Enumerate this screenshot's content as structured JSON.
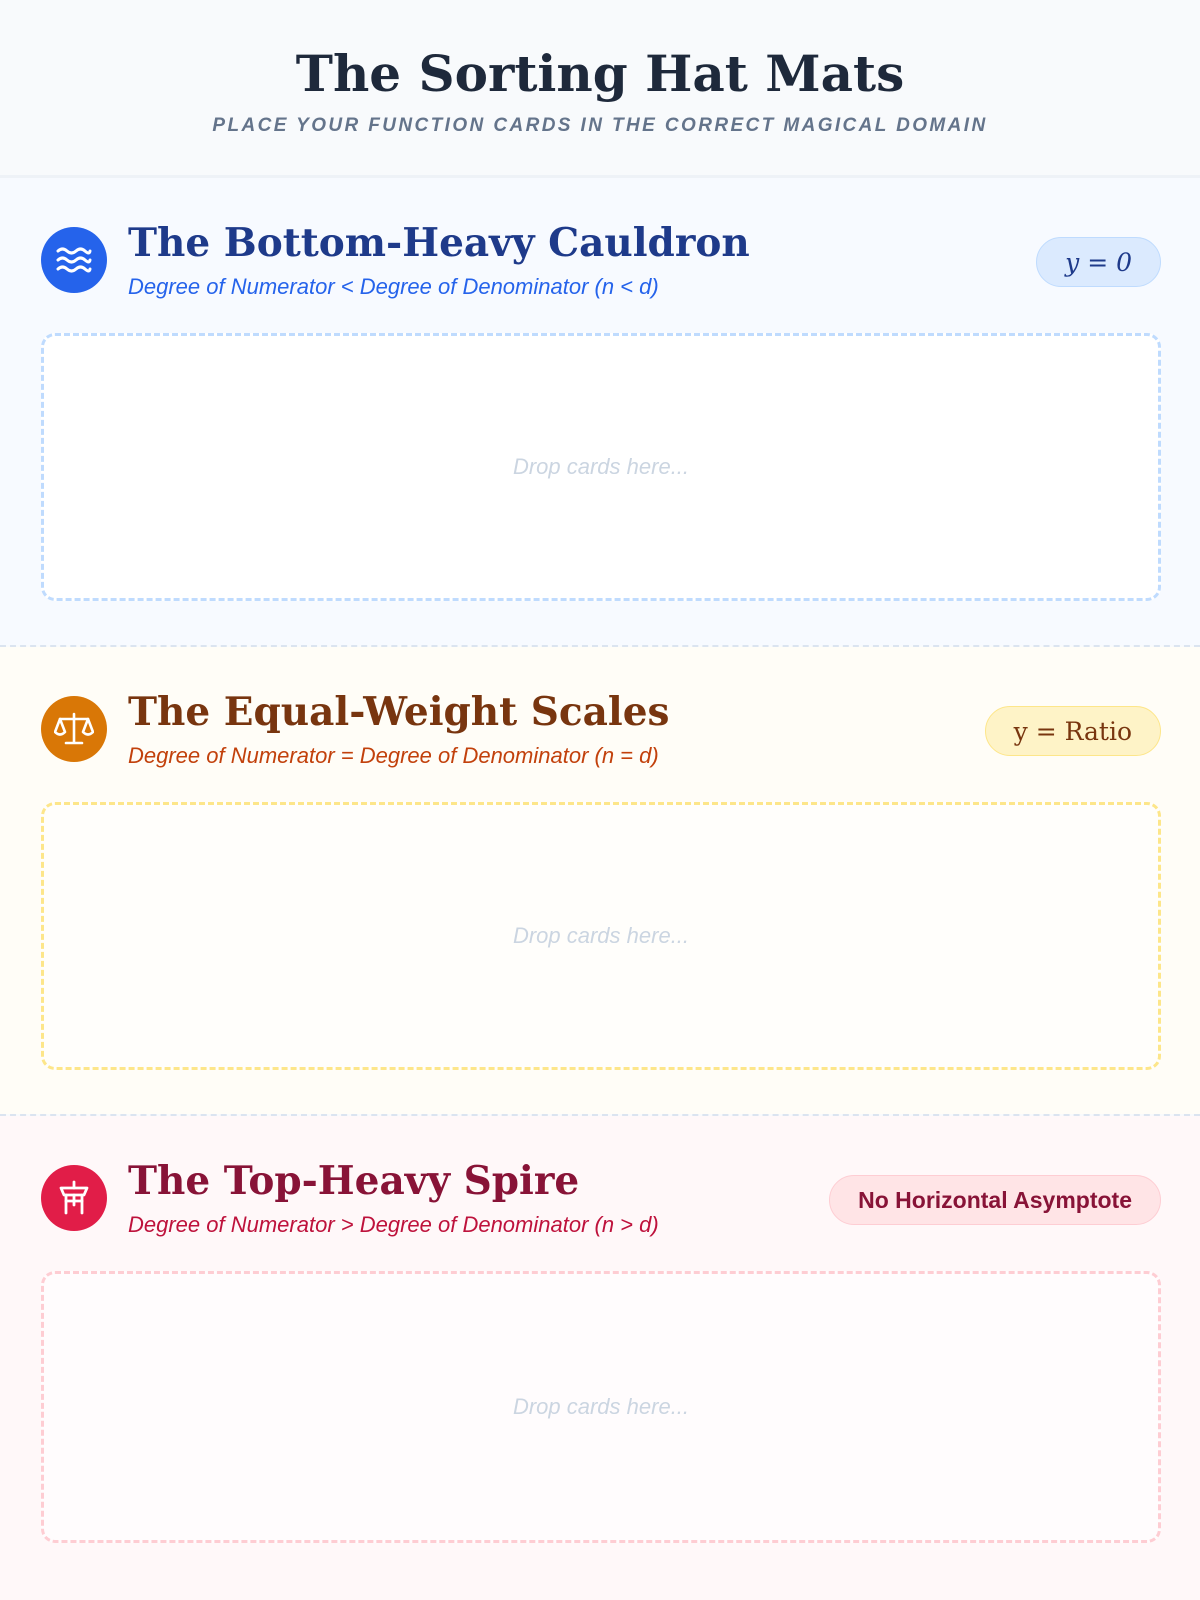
{
  "header": {
    "title": "The Sorting Hat Mats",
    "subtitle": "PLACE YOUR FUNCTION CARDS IN THE CORRECT MAGICAL DOMAIN"
  },
  "mats": [
    {
      "title": "The Bottom-Heavy Cauldron",
      "rule": "Degree of Numerator < Degree of Denominator (n < d)",
      "badge": "y = 0",
      "drop_placeholder": "Drop cards here...",
      "icon": "waves-icon",
      "color": "#2563eb"
    },
    {
      "title": "The Equal-Weight Scales",
      "rule": "Degree of Numerator = Degree of Denominator (n = d)",
      "badge": "y = Ratio",
      "drop_placeholder": "Drop cards here...",
      "icon": "scales-icon",
      "color": "#d97706"
    },
    {
      "title": "The Top-Heavy Spire",
      "rule": "Degree of Numerator > Degree of Denominator (n > d)",
      "badge": "No Horizontal Asymptote",
      "drop_placeholder": "Drop cards here...",
      "icon": "tower-icon",
      "color": "#e11d48"
    }
  ]
}
